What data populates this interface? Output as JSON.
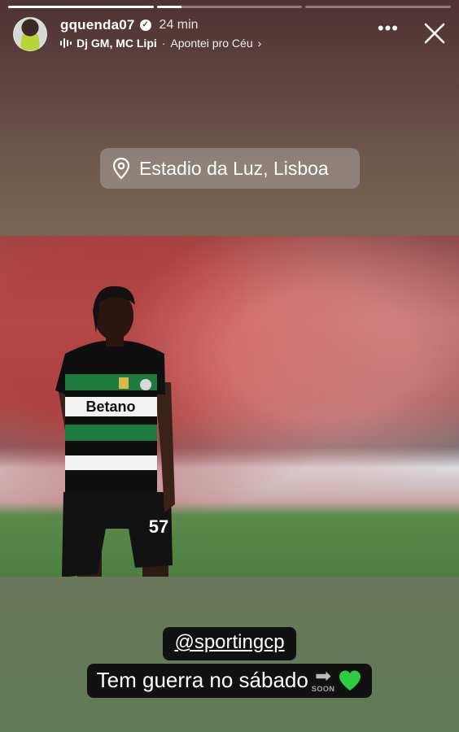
{
  "story": {
    "progress": [
      1.0,
      0.17,
      0.0
    ],
    "username": "gquenda07",
    "verified_icon": "verified-badge-icon",
    "time": "24 min",
    "music": {
      "icon": "audio-bars-icon",
      "artists": "Dj GM, MC Lipi",
      "separator": "·",
      "song": "Apontei pro Céu",
      "chevron": "›"
    },
    "more_icon": "more-icon",
    "close_icon": "close-icon"
  },
  "location": {
    "icon": "location-pin-icon",
    "label": "Estadio da Luz, Lisboa"
  },
  "photo": {
    "jersey_sponsor": "Betano",
    "shirt_number": "57"
  },
  "captions": {
    "mention": "@sportingcp",
    "text": "Tem guerra no sábado",
    "soon_label": "SOON",
    "emoji_icon": "green-heart-icon",
    "accent_color": "#2ecc40"
  }
}
